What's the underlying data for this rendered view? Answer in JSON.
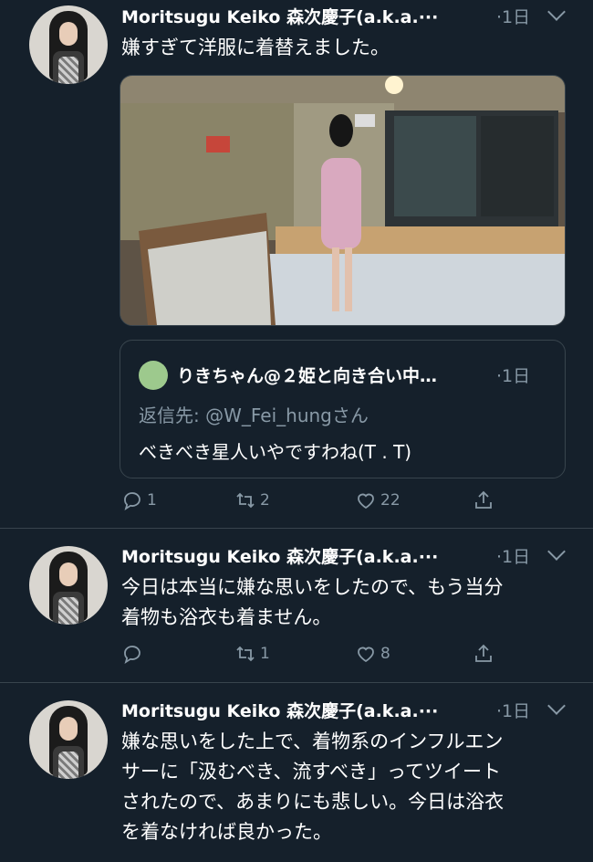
{
  "tweets": [
    {
      "author": "Moritsugu Keiko 森次慶子(a.k.a.···",
      "time": "·1日",
      "text_lines": [
        "嫌すぎて洋服に着替えました。"
      ],
      "quote": {
        "author": "りきちゃん@２姫と向き合い中…",
        "time": "·1日",
        "reply_to": "返信先: @W_Fei_hungさん",
        "text": "べきべき星人いやですわね(T . T)"
      },
      "replies": "1",
      "retweets": "2",
      "likes": "22"
    },
    {
      "author": "Moritsugu Keiko 森次慶子(a.k.a.···",
      "time": "·1日",
      "text_lines": [
        "今日は本当に嫌な思いをしたので、もう当分",
        "着物も浴衣も着ません。"
      ],
      "replies": "",
      "retweets": "1",
      "likes": "8"
    },
    {
      "author": "Moritsugu Keiko 森次慶子(a.k.a.···",
      "time": "·1日",
      "text_lines": [
        "嫌な思いをした上で、着物系のインフルエン",
        "サーに「汲むべき、流すべき」ってツイート",
        "されたので、あまりにも悲しい。今日は浴衣",
        "を着なければ良かった。"
      ]
    }
  ],
  "colors": {
    "background": "#15202b",
    "secondary": "#8899a6",
    "divider": "#38444d"
  }
}
